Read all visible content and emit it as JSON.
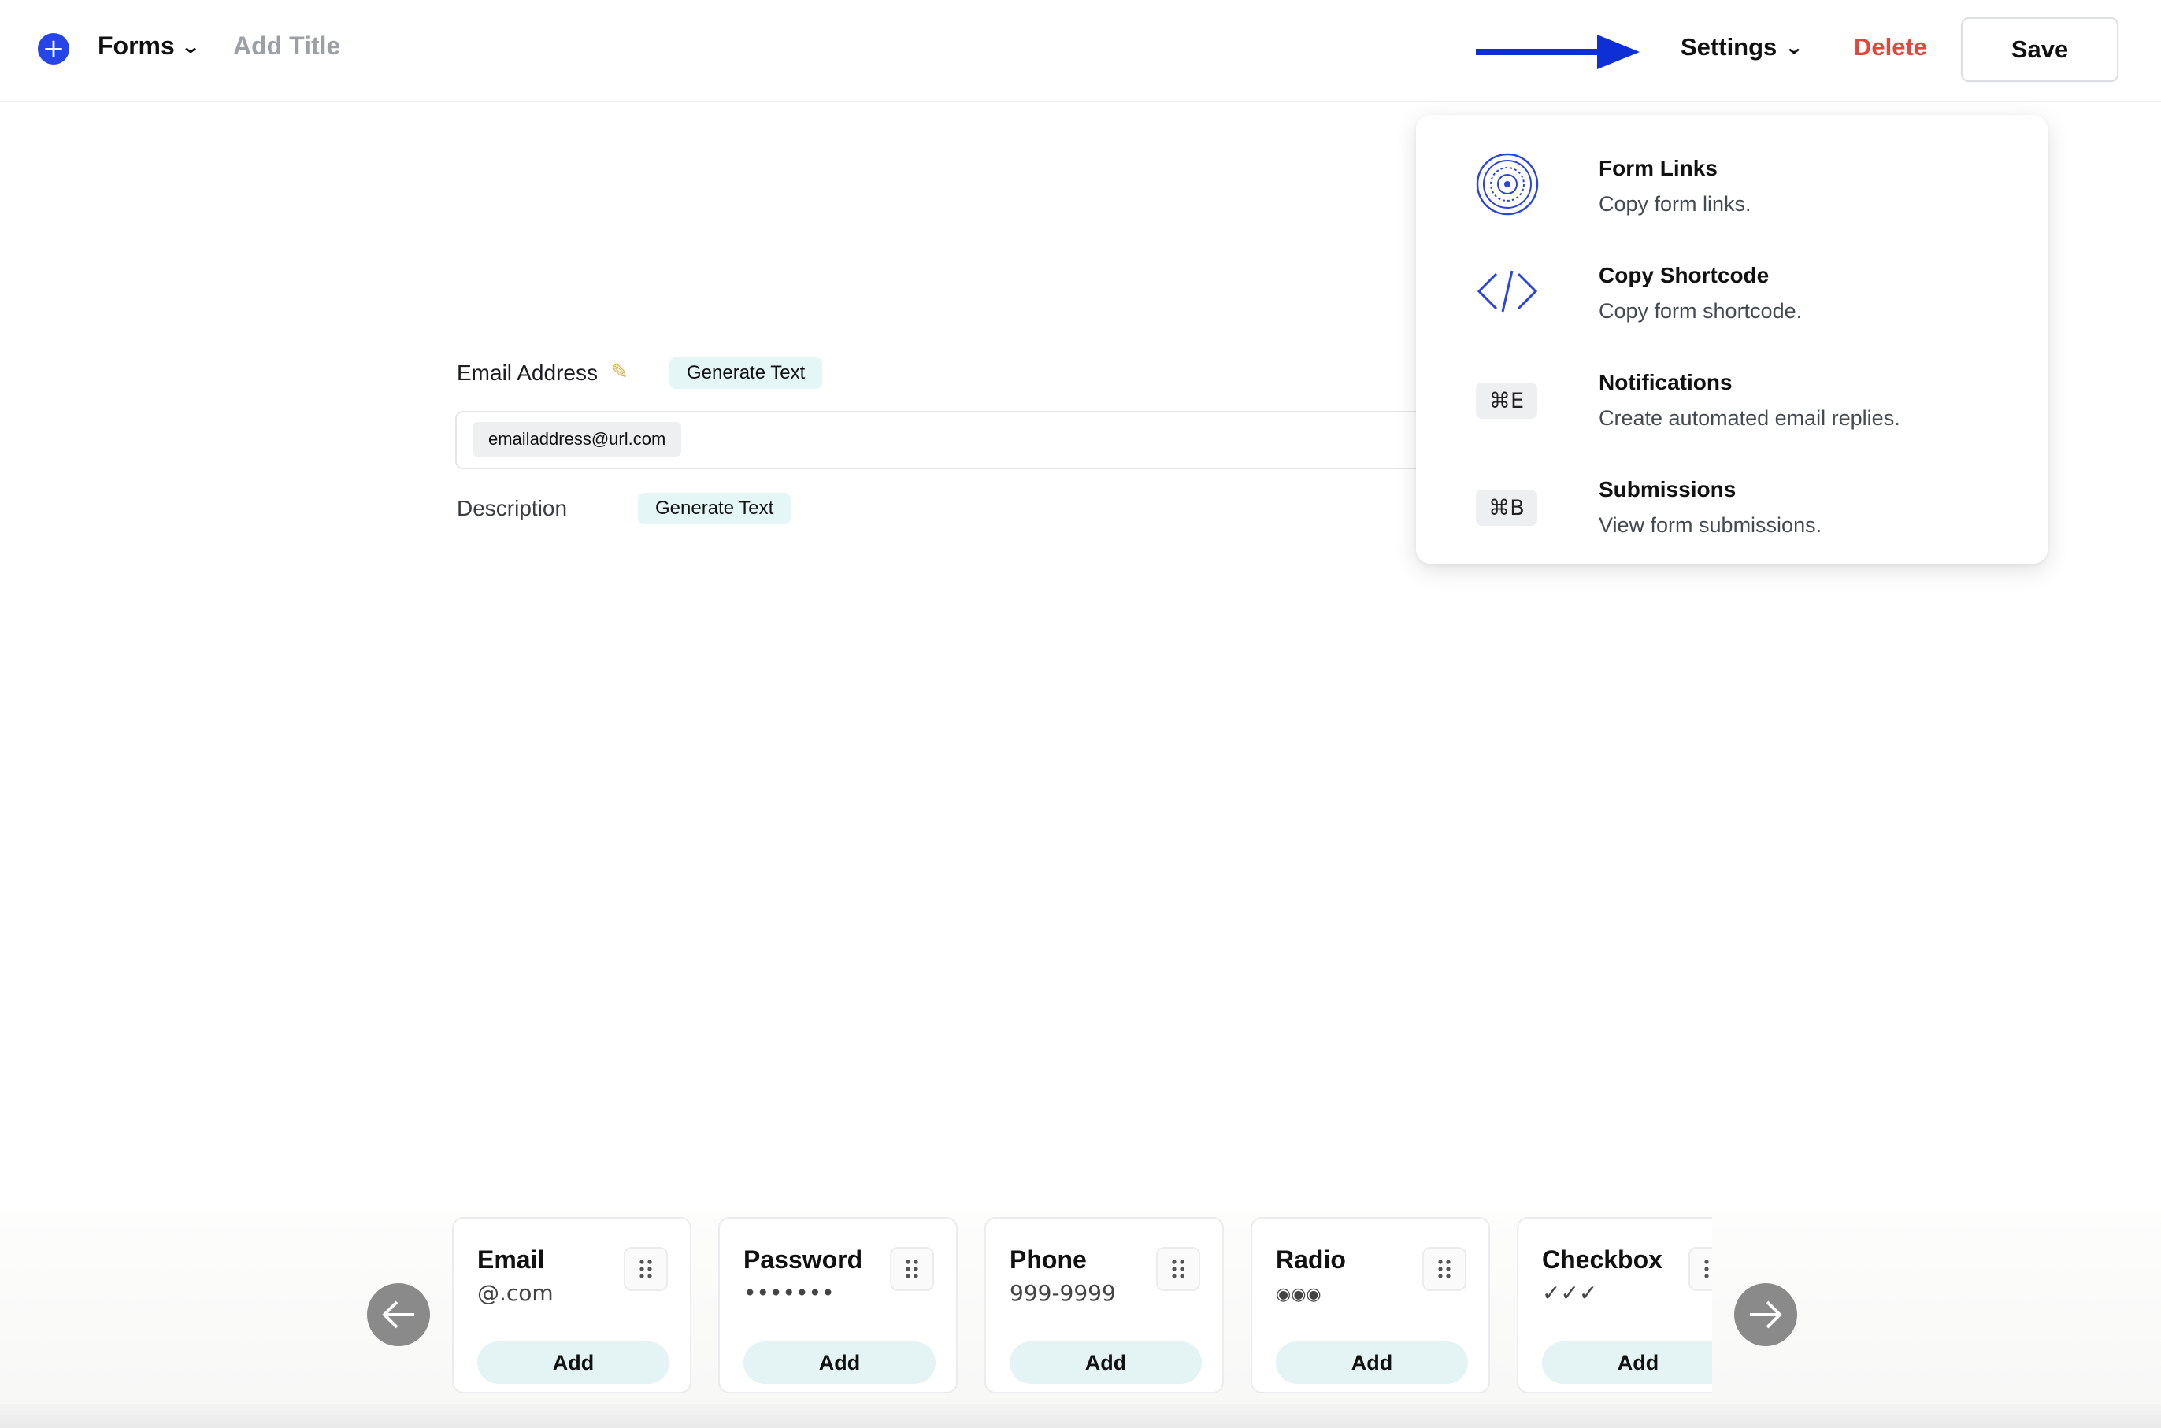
{
  "header": {
    "forms_label": "Forms",
    "add_title": "Add Title",
    "settings_label": "Settings",
    "delete_label": "Delete",
    "save_label": "Save"
  },
  "form": {
    "email_label": "Email Address",
    "email_generate": "Generate Text",
    "email_value": "emailaddress@url.com",
    "description_label": "Description",
    "description_generate": "Generate Text"
  },
  "settings_menu": {
    "items": [
      {
        "title": "Form Links",
        "desc": "Copy form links.",
        "icon": "concentric-circles-icon"
      },
      {
        "title": "Copy Shortcode",
        "desc": "Copy form shortcode.",
        "icon": "code-brackets-icon"
      },
      {
        "title": "Notifications",
        "desc": "Create automated email replies.",
        "shortcut": "⌘E"
      },
      {
        "title": "Submissions",
        "desc": "View form submissions.",
        "shortcut": "⌘B"
      }
    ]
  },
  "palette": {
    "cards": [
      {
        "title": "Email",
        "sample": "@.com",
        "add": "Add"
      },
      {
        "title": "Password",
        "sample": "•••••••",
        "add": "Add"
      },
      {
        "title": "Phone",
        "sample": "999-9999",
        "add": "Add"
      },
      {
        "title": "Radio",
        "sample": "◉◉◉",
        "add": "Add"
      },
      {
        "title": "Checkbox",
        "sample": "✓✓✓",
        "add": "Add"
      }
    ]
  },
  "colors": {
    "accent": "#2545e8",
    "highlight_border": "#0f2fd6",
    "delete": "#e1483d",
    "chip_teal": "#e4f6f6"
  }
}
